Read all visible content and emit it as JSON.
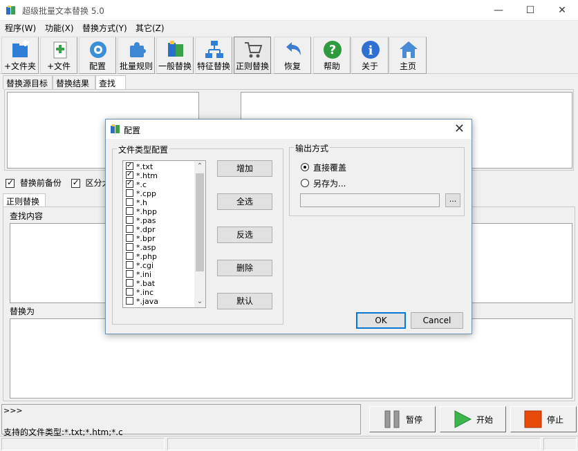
{
  "window": {
    "title": "超级批量文本替换 5.0"
  },
  "menu": [
    "程序(W)",
    "功能(X)",
    "替换方式(Y)",
    "其它(Z)"
  ],
  "toolbar": [
    {
      "label": "+文件夹",
      "icon": "add-folder-icon"
    },
    {
      "label": "+文件",
      "icon": "add-file-icon"
    },
    {
      "label": "配置",
      "icon": "config-icon"
    },
    {
      "label": "批量规则",
      "icon": "puzzle-icon"
    },
    {
      "label": "一般替换",
      "icon": "replace-icon"
    },
    {
      "label": "特征替换",
      "icon": "network-icon"
    },
    {
      "label": "正则替换",
      "icon": "cart-icon"
    },
    {
      "label": "恢复",
      "icon": "undo-icon"
    },
    {
      "label": "帮助",
      "icon": "help-icon"
    },
    {
      "label": "关于",
      "icon": "info-icon"
    },
    {
      "label": "主页",
      "icon": "home-icon"
    }
  ],
  "upper_tabs": [
    "替换源目标",
    "替换结果",
    "查找"
  ],
  "options": {
    "backup": "替换前备份",
    "case": "区分大小"
  },
  "lower_tabs": [
    "正则替换"
  ],
  "labels": {
    "find": "查找内容",
    "replace": "替换为"
  },
  "log": {
    "prompt": ">>>",
    "supported": "支持的文件类型:*.txt;*.htm;*.c"
  },
  "actions": {
    "pause": "暂停",
    "start": "开始",
    "stop": "停止"
  },
  "dialog": {
    "title": "配置",
    "filetype_group": "文件类型配置",
    "filetypes": [
      {
        "name": "*.txt",
        "checked": true
      },
      {
        "name": "*.htm",
        "checked": true
      },
      {
        "name": "*.c",
        "checked": true
      },
      {
        "name": "*.cpp",
        "checked": false
      },
      {
        "name": "*.h",
        "checked": false
      },
      {
        "name": "*.hpp",
        "checked": false
      },
      {
        "name": "*.pas",
        "checked": false
      },
      {
        "name": "*.dpr",
        "checked": false
      },
      {
        "name": "*.bpr",
        "checked": false
      },
      {
        "name": "*.asp",
        "checked": false
      },
      {
        "name": "*.php",
        "checked": false
      },
      {
        "name": "*.cgi",
        "checked": false
      },
      {
        "name": "*.ini",
        "checked": false
      },
      {
        "name": "*.bat",
        "checked": false
      },
      {
        "name": "*.inc",
        "checked": false
      },
      {
        "name": "*.java",
        "checked": false
      }
    ],
    "buttons": {
      "add": "增加",
      "select_all": "全选",
      "invert": "反选",
      "delete": "删除",
      "default": "默认"
    },
    "output_group": "输出方式",
    "output_overwrite": "直接覆盖",
    "output_saveas": "另存为...",
    "browse": "...",
    "ok": "OK",
    "cancel": "Cancel"
  }
}
